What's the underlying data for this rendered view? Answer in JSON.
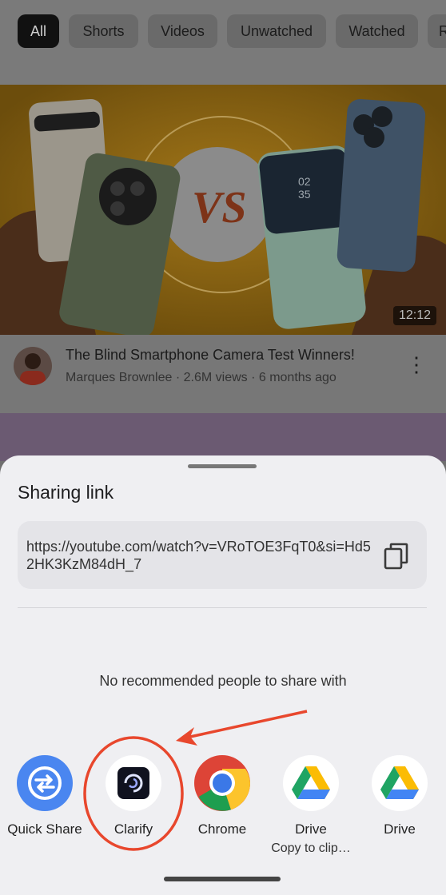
{
  "filters": [
    "All",
    "Shorts",
    "Videos",
    "Unwatched",
    "Watched",
    "R"
  ],
  "video": {
    "thumb_text": "VS",
    "phone_time_top": "02",
    "phone_time_bottom": "35",
    "duration": "12:12",
    "title": "The Blind Smartphone Camera Test Winners!",
    "meta": "Marques Brownlee · 2.6M views · 6 months ago"
  },
  "share": {
    "title": "Sharing link",
    "link": "https://youtube.com/watch?v=VRoTOE3FqT0&si=Hd52HK3KzM84dH_7",
    "no_recommended": "No recommended people to share with",
    "apps": [
      {
        "label": "Quick Share",
        "sub": ""
      },
      {
        "label": "Clarify",
        "sub": ""
      },
      {
        "label": "Chrome",
        "sub": ""
      },
      {
        "label": "Drive",
        "sub": "Copy to clip…"
      },
      {
        "label": "Drive",
        "sub": ""
      }
    ]
  },
  "colors": {
    "annotation": "#e8472d",
    "quick_share": "#4a86f0",
    "clarify_bg": "#10121f"
  }
}
